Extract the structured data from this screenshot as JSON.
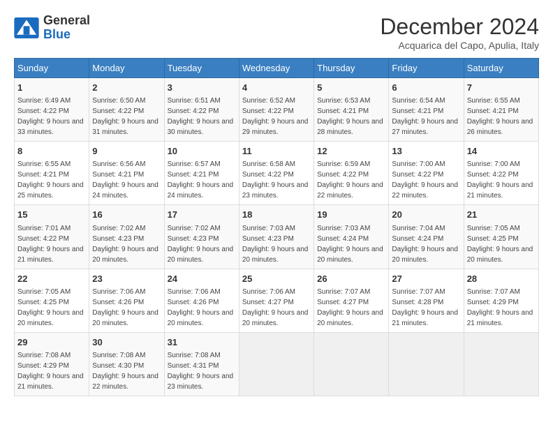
{
  "header": {
    "logo": {
      "general": "General",
      "blue": "Blue"
    },
    "title": "December 2024",
    "subtitle": "Acquarica del Capo, Apulia, Italy"
  },
  "weekdays": [
    "Sunday",
    "Monday",
    "Tuesday",
    "Wednesday",
    "Thursday",
    "Friday",
    "Saturday"
  ],
  "weeks": [
    [
      {
        "day": "1",
        "sunrise": "6:49 AM",
        "sunset": "4:22 PM",
        "daylight": "9 hours and 33 minutes."
      },
      {
        "day": "2",
        "sunrise": "6:50 AM",
        "sunset": "4:22 PM",
        "daylight": "9 hours and 31 minutes."
      },
      {
        "day": "3",
        "sunrise": "6:51 AM",
        "sunset": "4:22 PM",
        "daylight": "9 hours and 30 minutes."
      },
      {
        "day": "4",
        "sunrise": "6:52 AM",
        "sunset": "4:22 PM",
        "daylight": "9 hours and 29 minutes."
      },
      {
        "day": "5",
        "sunrise": "6:53 AM",
        "sunset": "4:21 PM",
        "daylight": "9 hours and 28 minutes."
      },
      {
        "day": "6",
        "sunrise": "6:54 AM",
        "sunset": "4:21 PM",
        "daylight": "9 hours and 27 minutes."
      },
      {
        "day": "7",
        "sunrise": "6:55 AM",
        "sunset": "4:21 PM",
        "daylight": "9 hours and 26 minutes."
      }
    ],
    [
      {
        "day": "8",
        "sunrise": "6:55 AM",
        "sunset": "4:21 PM",
        "daylight": "9 hours and 25 minutes."
      },
      {
        "day": "9",
        "sunrise": "6:56 AM",
        "sunset": "4:21 PM",
        "daylight": "9 hours and 24 minutes."
      },
      {
        "day": "10",
        "sunrise": "6:57 AM",
        "sunset": "4:21 PM",
        "daylight": "9 hours and 24 minutes."
      },
      {
        "day": "11",
        "sunrise": "6:58 AM",
        "sunset": "4:22 PM",
        "daylight": "9 hours and 23 minutes."
      },
      {
        "day": "12",
        "sunrise": "6:59 AM",
        "sunset": "4:22 PM",
        "daylight": "9 hours and 22 minutes."
      },
      {
        "day": "13",
        "sunrise": "7:00 AM",
        "sunset": "4:22 PM",
        "daylight": "9 hours and 22 minutes."
      },
      {
        "day": "14",
        "sunrise": "7:00 AM",
        "sunset": "4:22 PM",
        "daylight": "9 hours and 21 minutes."
      }
    ],
    [
      {
        "day": "15",
        "sunrise": "7:01 AM",
        "sunset": "4:22 PM",
        "daylight": "9 hours and 21 minutes."
      },
      {
        "day": "16",
        "sunrise": "7:02 AM",
        "sunset": "4:23 PM",
        "daylight": "9 hours and 20 minutes."
      },
      {
        "day": "17",
        "sunrise": "7:02 AM",
        "sunset": "4:23 PM",
        "daylight": "9 hours and 20 minutes."
      },
      {
        "day": "18",
        "sunrise": "7:03 AM",
        "sunset": "4:23 PM",
        "daylight": "9 hours and 20 minutes."
      },
      {
        "day": "19",
        "sunrise": "7:03 AM",
        "sunset": "4:24 PM",
        "daylight": "9 hours and 20 minutes."
      },
      {
        "day": "20",
        "sunrise": "7:04 AM",
        "sunset": "4:24 PM",
        "daylight": "9 hours and 20 minutes."
      },
      {
        "day": "21",
        "sunrise": "7:05 AM",
        "sunset": "4:25 PM",
        "daylight": "9 hours and 20 minutes."
      }
    ],
    [
      {
        "day": "22",
        "sunrise": "7:05 AM",
        "sunset": "4:25 PM",
        "daylight": "9 hours and 20 minutes."
      },
      {
        "day": "23",
        "sunrise": "7:06 AM",
        "sunset": "4:26 PM",
        "daylight": "9 hours and 20 minutes."
      },
      {
        "day": "24",
        "sunrise": "7:06 AM",
        "sunset": "4:26 PM",
        "daylight": "9 hours and 20 minutes."
      },
      {
        "day": "25",
        "sunrise": "7:06 AM",
        "sunset": "4:27 PM",
        "daylight": "9 hours and 20 minutes."
      },
      {
        "day": "26",
        "sunrise": "7:07 AM",
        "sunset": "4:27 PM",
        "daylight": "9 hours and 20 minutes."
      },
      {
        "day": "27",
        "sunrise": "7:07 AM",
        "sunset": "4:28 PM",
        "daylight": "9 hours and 21 minutes."
      },
      {
        "day": "28",
        "sunrise": "7:07 AM",
        "sunset": "4:29 PM",
        "daylight": "9 hours and 21 minutes."
      }
    ],
    [
      {
        "day": "29",
        "sunrise": "7:08 AM",
        "sunset": "4:29 PM",
        "daylight": "9 hours and 21 minutes."
      },
      {
        "day": "30",
        "sunrise": "7:08 AM",
        "sunset": "4:30 PM",
        "daylight": "9 hours and 22 minutes."
      },
      {
        "day": "31",
        "sunrise": "7:08 AM",
        "sunset": "4:31 PM",
        "daylight": "9 hours and 23 minutes."
      },
      null,
      null,
      null,
      null
    ]
  ]
}
